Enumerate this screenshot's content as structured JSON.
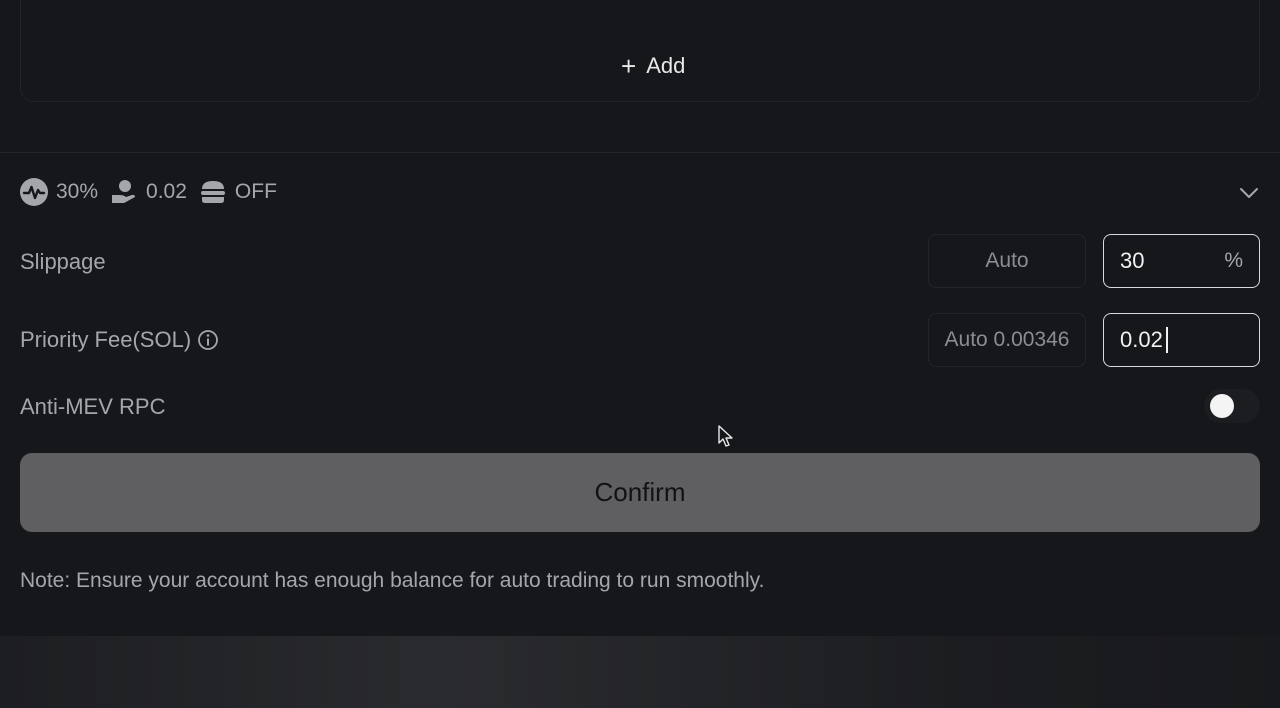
{
  "add_card": {
    "add_label": "Add"
  },
  "summary": {
    "slippage": "30%",
    "priority_fee": "0.02",
    "anti_mev": "OFF"
  },
  "slippage": {
    "label": "Slippage",
    "auto_label": "Auto",
    "value": "30",
    "unit": "%"
  },
  "priority_fee": {
    "label": "Priority Fee(SOL)",
    "auto_label": "Auto 0.00346",
    "value": "0.02"
  },
  "anti_mev": {
    "label": "Anti-MEV RPC",
    "enabled": false
  },
  "confirm_label": "Confirm",
  "note": "Note: Ensure your account has enough balance for auto trading to run smoothly."
}
